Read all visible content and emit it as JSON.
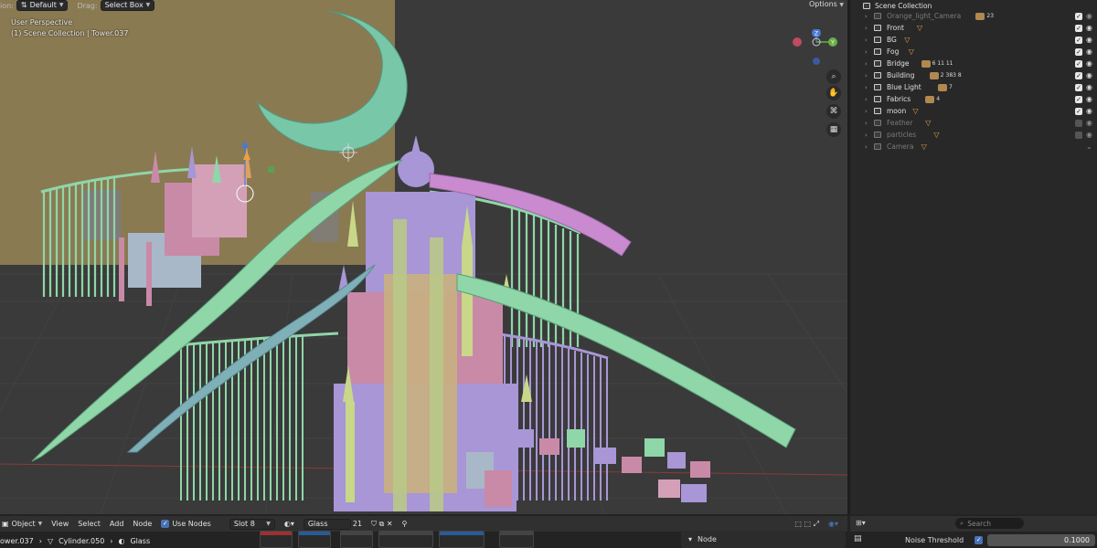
{
  "viewport": {
    "header": {
      "orientation_label": "ion:",
      "orientation_value": "Default",
      "drag_label": "Drag:",
      "drag_value": "Select Box",
      "options_label": "Options"
    },
    "info_line1": "User Perspective",
    "info_line2": "(1) Scene Collection | Tower.037",
    "gizmo": {
      "z": "Z",
      "y": "Y"
    }
  },
  "outliner": {
    "root": "Scene Collection",
    "items": [
      {
        "name": "Orange_light_Camera",
        "dim": true,
        "extra": "23",
        "checked": true
      },
      {
        "name": "Front",
        "dim": false,
        "extra": "",
        "checked": true
      },
      {
        "name": "BG",
        "dim": false,
        "extra": "",
        "checked": true
      },
      {
        "name": "Fog",
        "dim": false,
        "extra": "",
        "checked": true
      },
      {
        "name": "Bridge",
        "dim": false,
        "extra": "6 11 11",
        "checked": true
      },
      {
        "name": "Building",
        "dim": false,
        "extra": "2 383 8",
        "checked": true
      },
      {
        "name": "Blue Light",
        "dim": false,
        "extra": "7",
        "checked": true
      },
      {
        "name": "Fabrics",
        "dim": false,
        "extra": "4",
        "checked": true
      },
      {
        "name": "moon",
        "dim": false,
        "extra": "",
        "checked": true
      },
      {
        "name": "Feather",
        "dim": true,
        "extra": "",
        "checked": false
      },
      {
        "name": "particles",
        "dim": true,
        "extra": "",
        "checked": false
      },
      {
        "name": "Camera",
        "dim": true,
        "extra": "",
        "checked": null
      }
    ]
  },
  "node_editor": {
    "mode": "Object",
    "menu_view": "View",
    "menu_select": "Select",
    "menu_add": "Add",
    "menu_node": "Node",
    "use_nodes": "Use Nodes",
    "slot": "Slot 8",
    "material": "Glass",
    "users": "21",
    "breadcrumb_obj": "ower.037",
    "breadcrumb_mesh": "Cylinder.050",
    "breadcrumb_mat": "Glass",
    "panel_label": "Node"
  },
  "properties": {
    "search_placeholder": "Search",
    "noise_threshold_label": "Noise Threshold",
    "noise_threshold_value": "0.1000"
  },
  "colors": {
    "viewport_bg": "#3a3a3a",
    "backdrop": "#8a7a52",
    "moon": "#78c7a8",
    "mint": "#8fd6a8",
    "pink": "#c98aa8",
    "lavender": "#a896d6",
    "teal_blue": "#7fb0b8",
    "accent_blue": "#4772b3"
  }
}
